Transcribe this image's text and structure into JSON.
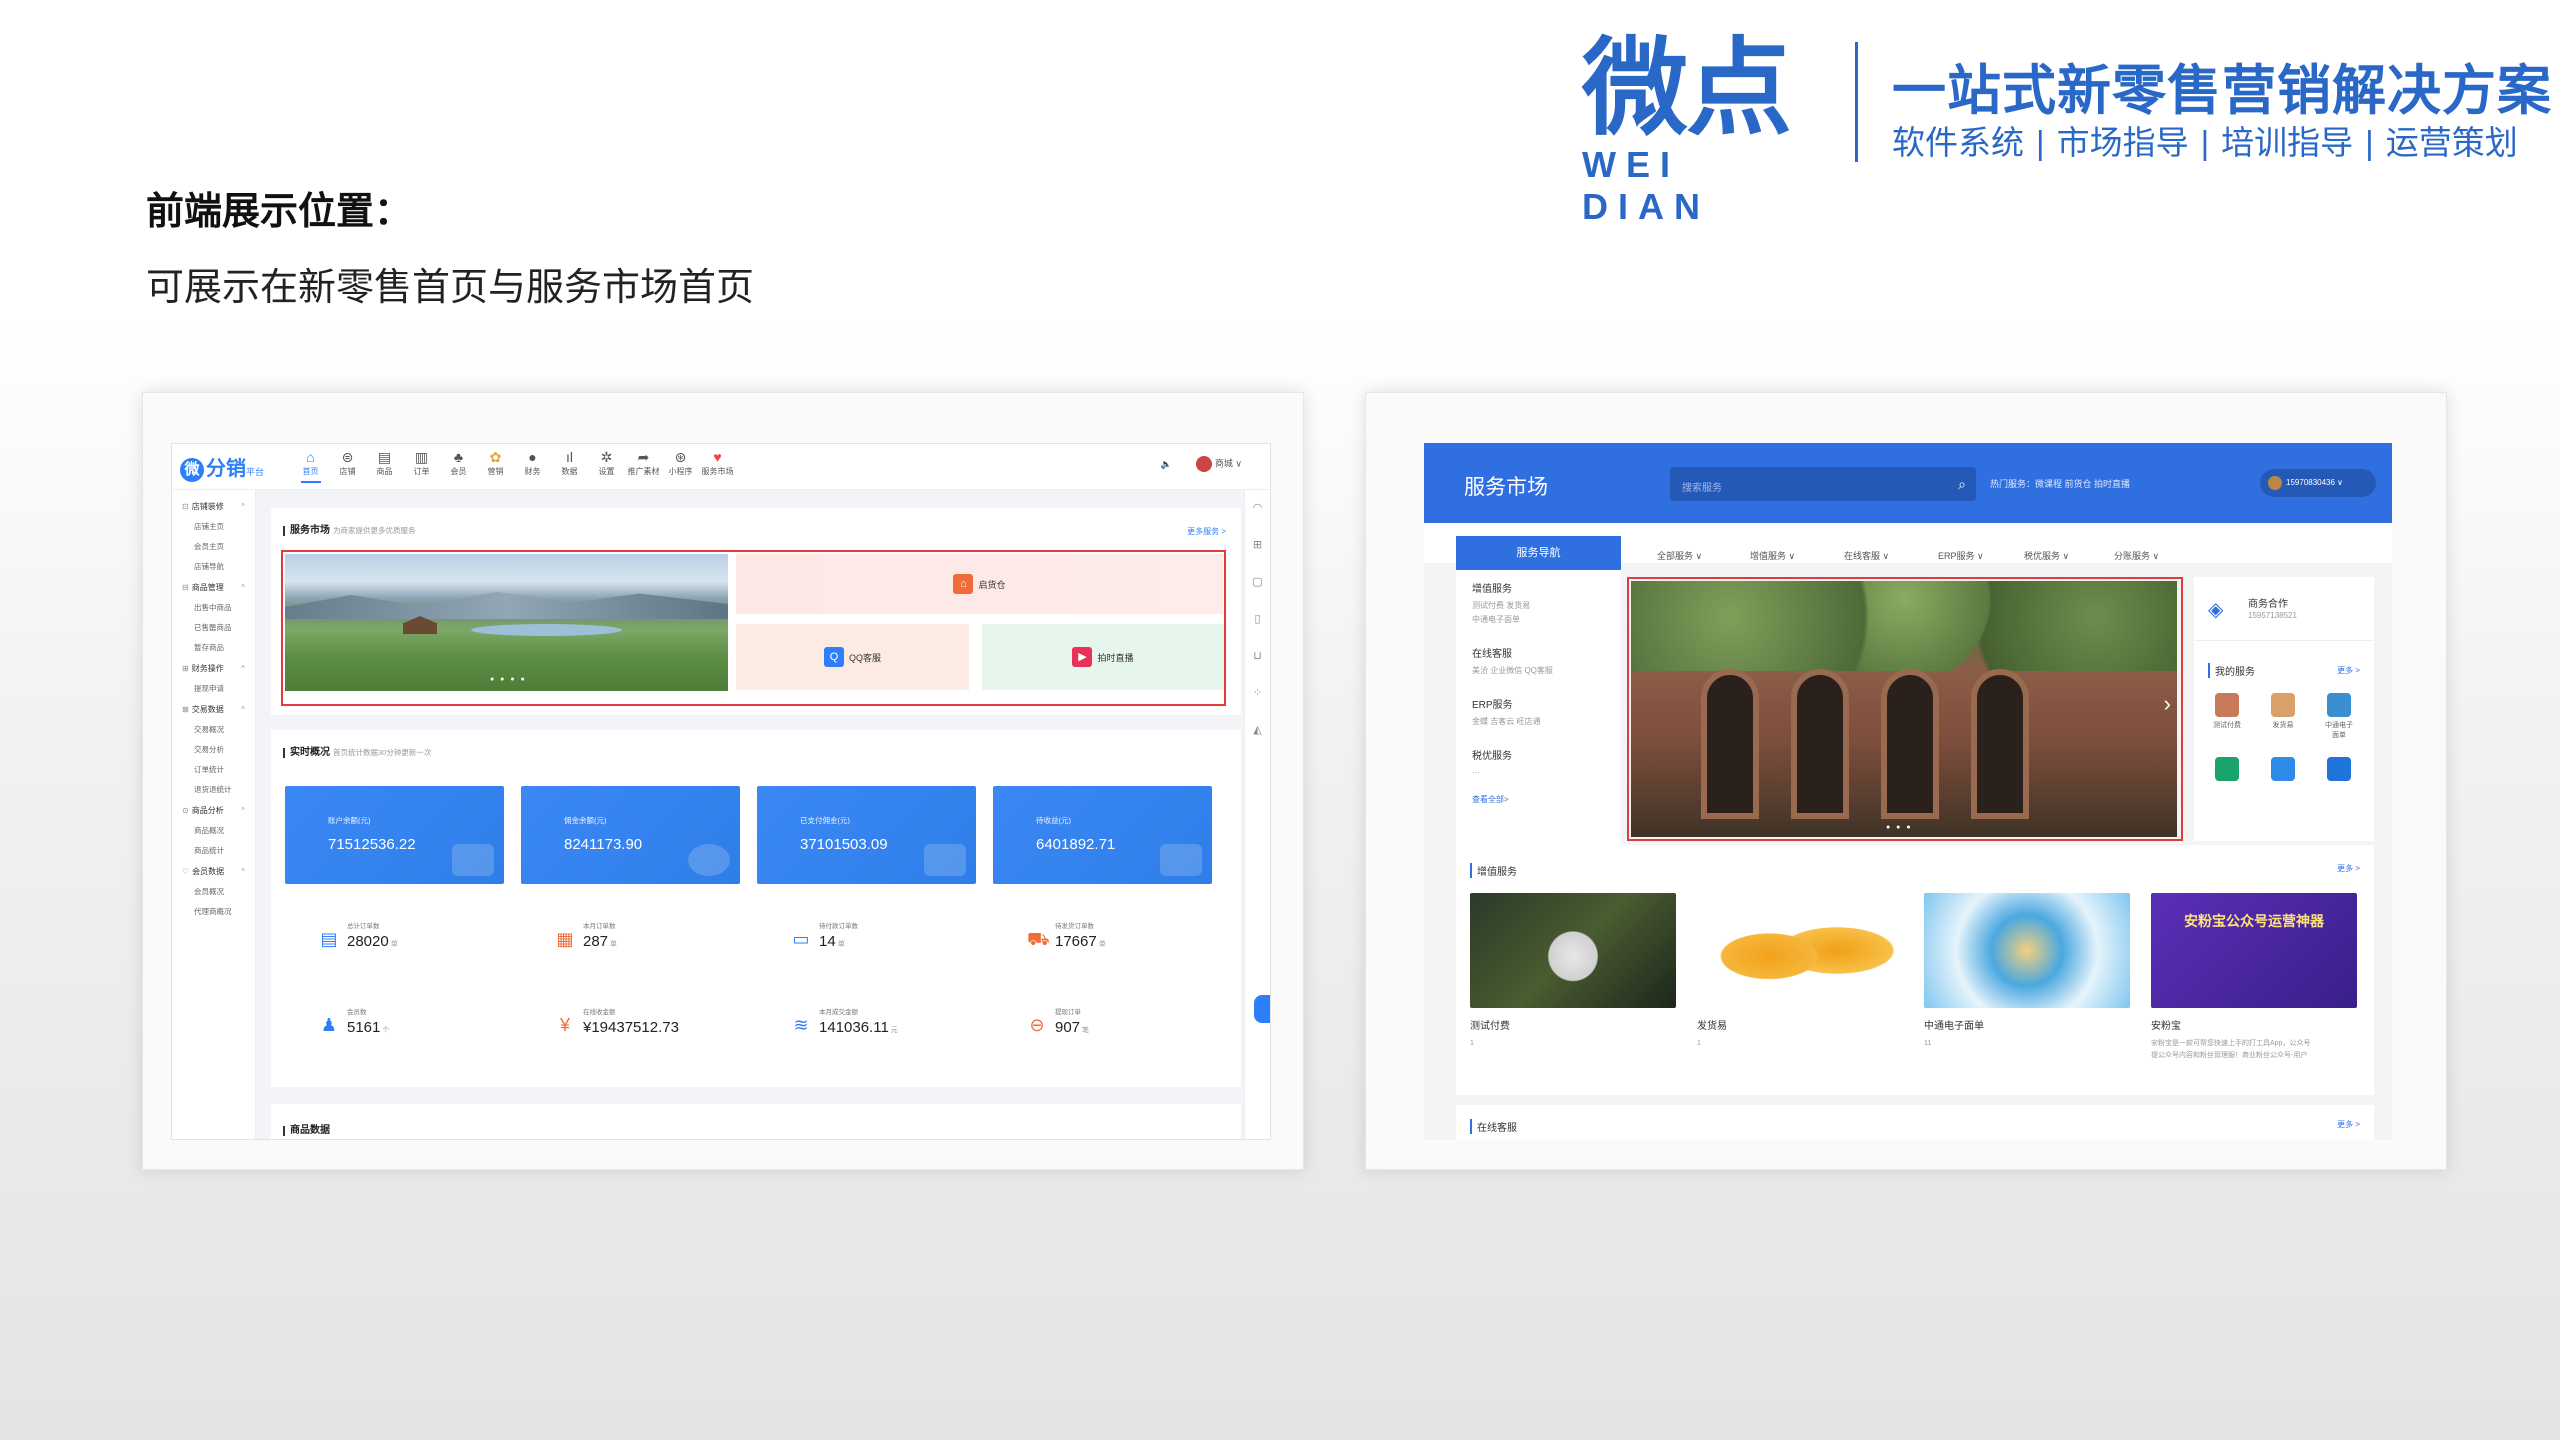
{
  "brand": {
    "logo_cn": "微点",
    "logo_en": "WEI DIAN",
    "tagline": "一站式新零售营销解决方案",
    "services": [
      "软件系统",
      "市场指导",
      "培训指导",
      "运营策划"
    ]
  },
  "section": {
    "title": "前端展示位置：",
    "desc": "可展示在新零售首页与服务市场首页"
  },
  "left_app": {
    "logo": "分销",
    "logo_sub": "平台",
    "nav": [
      "首页",
      "店铺",
      "商品",
      "订单",
      "会员",
      "营销",
      "财务",
      "数据",
      "设置",
      "推广素材",
      "小程序",
      "服务市场"
    ],
    "user": "商城",
    "sidebar": [
      {
        "group": "店铺装修",
        "items": [
          "店铺主页",
          "会员主页",
          "店铺导航"
        ]
      },
      {
        "group": "商品管理",
        "items": [
          "出售中商品",
          "已售罄商品",
          "暂存商品"
        ]
      },
      {
        "group": "财务操作",
        "items": [
          "提现申请"
        ]
      },
      {
        "group": "交易数据",
        "items": [
          "交易概况",
          "交易分析",
          "订单统计",
          "退货退统计"
        ]
      },
      {
        "group": "商品分析",
        "items": [
          "商品概况",
          "商品统计"
        ]
      },
      {
        "group": "会员数据",
        "items": [
          "会员概况",
          "代理商概况"
        ]
      }
    ],
    "market": {
      "title": "服务市场",
      "subtitle": "为商家提供更多优质服务",
      "more": "更多服务 >",
      "tiles": [
        "启货仓",
        "QQ客服",
        "拍时直播"
      ]
    },
    "realtime": {
      "title": "实时概况",
      "subtitle": "首页统计数据30分钟更新一次",
      "stats": [
        {
          "label": "账户余额(元)",
          "value": "71512536.22"
        },
        {
          "label": "佣金余额(元)",
          "value": "8241173.90"
        },
        {
          "label": "已支付佣金(元)",
          "value": "37101503.09"
        },
        {
          "label": "待收益(元)",
          "value": "6401892.71"
        }
      ],
      "counts": [
        {
          "label": "总计订单数",
          "value": "28020",
          "unit": "单"
        },
        {
          "label": "本月订单数",
          "value": "287",
          "unit": "单"
        },
        {
          "label": "待付款订单数",
          "value": "14",
          "unit": "单"
        },
        {
          "label": "待发货订单数",
          "value": "17667",
          "unit": "单"
        },
        {
          "label": "会员数",
          "value": "5161",
          "unit": "个"
        },
        {
          "label": "在线收金额",
          "value": "¥19437512.73",
          "unit": ""
        },
        {
          "label": "本月成交金额",
          "value": "141036.11",
          "unit": "元"
        },
        {
          "label": "提现订单",
          "value": "907",
          "unit": "笔"
        }
      ]
    },
    "goods": {
      "title": "商品数据"
    }
  },
  "right_app": {
    "title": "服务市场",
    "search_placeholder": "搜索服务",
    "hot": "热门服务：微课程  前货仓  拍时直播",
    "user": "15970830436",
    "nav_active": "服务导航",
    "tabs": [
      "全部服务 ∨",
      "增值服务 ∨",
      "在线客服 ∨",
      "ERP服务 ∨",
      "税优服务 ∨",
      "分账服务 ∨"
    ],
    "left_menu": [
      {
        "title": "增值服务",
        "sub": "测试付费  发货易\n中通电子面单"
      },
      {
        "title": "在线客服",
        "sub": "美洽  企业微信  QQ客服"
      },
      {
        "title": "ERP服务",
        "sub": "金蝶  吉客云  旺店通"
      },
      {
        "title": "税优服务",
        "sub": "···"
      }
    ],
    "left_more": "查看全部>",
    "partner": {
      "title": "商务合作",
      "phone": "15957138521"
    },
    "my_services": {
      "title": "我的服务",
      "more": "更多 >",
      "apps": [
        "测试付费",
        "发货易",
        "中通电子面单",
        "",
        "",
        ""
      ]
    },
    "value_added": {
      "title": "增值服务",
      "more": "更多 >",
      "products": [
        {
          "name": "测试付费",
          "desc": "1"
        },
        {
          "name": "发货易",
          "desc": "1"
        },
        {
          "name": "中通电子面单",
          "desc": "11"
        },
        {
          "name": "安粉宝",
          "desc": "安粉宝是一款可帮您快速上手的打工具App，公众号\n提公众号内容和粉丝管理服！商业粉丝公众号-用户"
        }
      ],
      "banner4": "安粉宝公众号运营神器"
    },
    "online_cs": {
      "title": "在线客服",
      "more": "更多 >"
    }
  }
}
